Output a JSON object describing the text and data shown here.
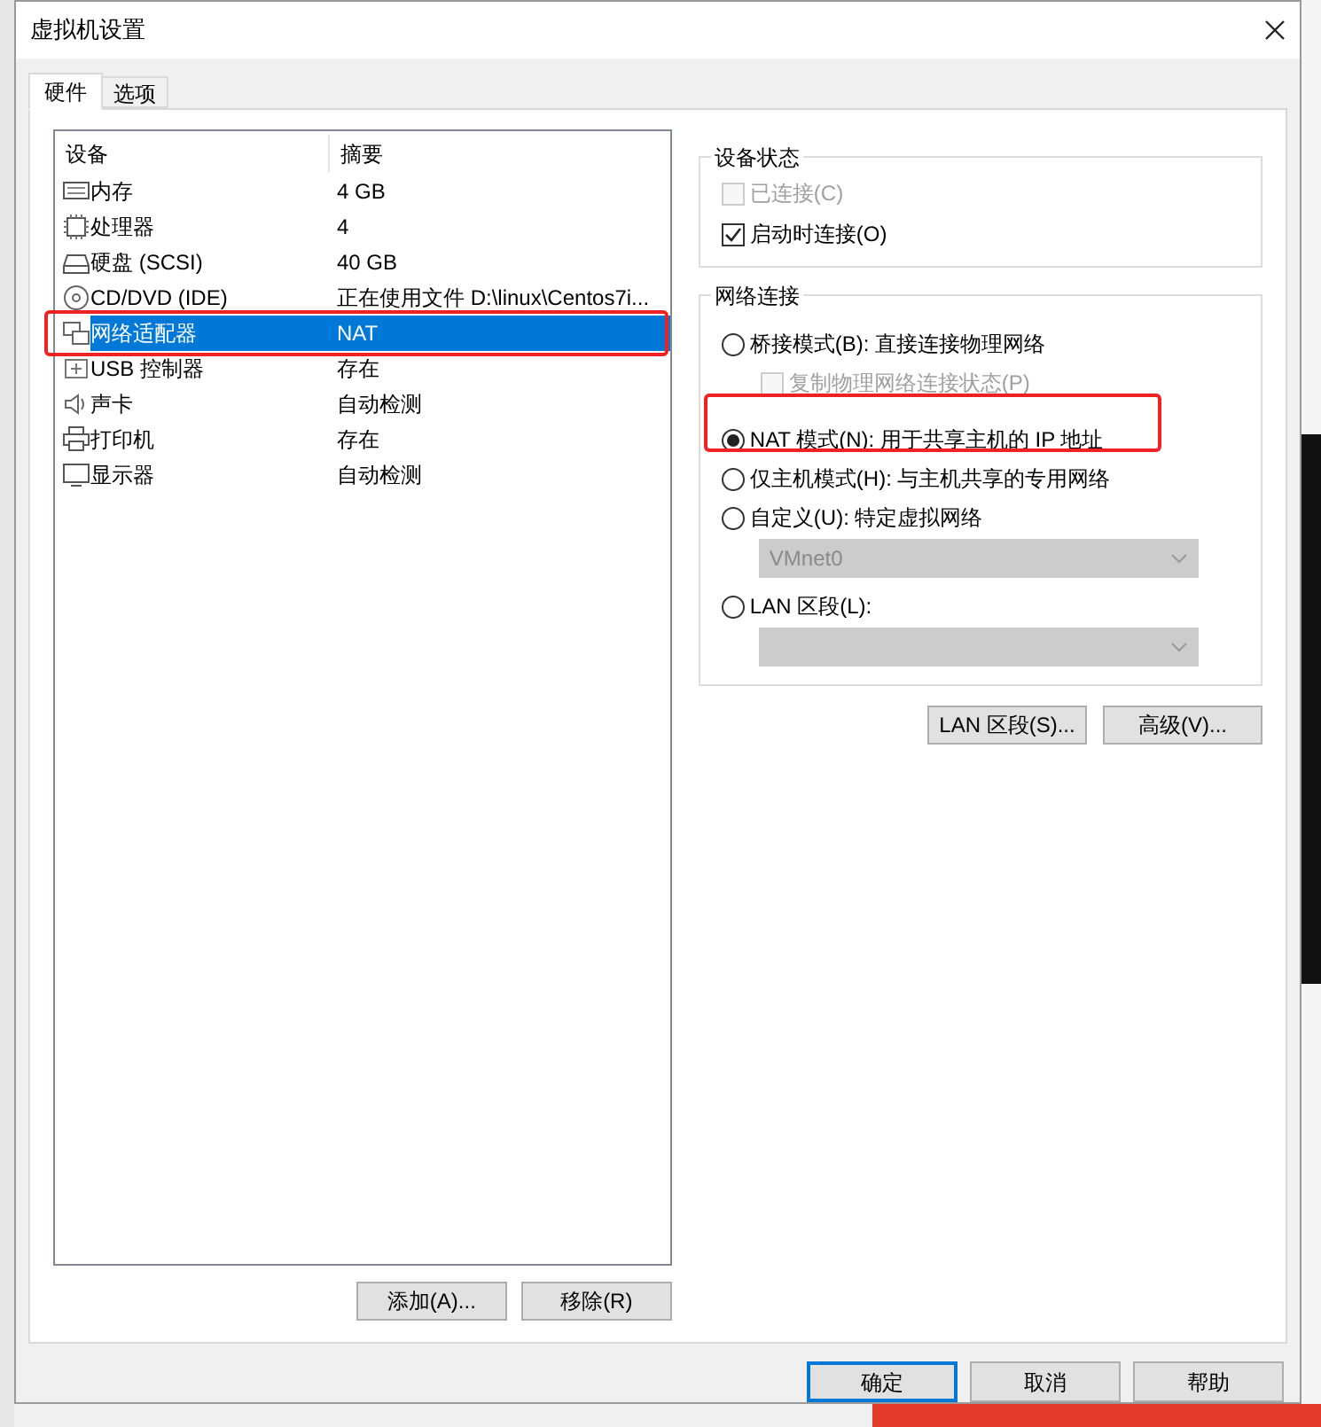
{
  "window": {
    "title": "虚拟机设置"
  },
  "tabs": [
    {
      "label": "硬件",
      "selected": true
    },
    {
      "label": "选项",
      "selected": false
    }
  ],
  "device_table": {
    "columns": [
      "设备",
      "摘要"
    ],
    "rows": [
      {
        "kind": "memory",
        "device": "内存",
        "summary": "4 GB",
        "selected": false
      },
      {
        "kind": "cpu",
        "device": "处理器",
        "summary": "4",
        "selected": false
      },
      {
        "kind": "disk",
        "device": "硬盘 (SCSI)",
        "summary": "40 GB",
        "selected": false
      },
      {
        "kind": "cd",
        "device": "CD/DVD (IDE)",
        "summary": "正在使用文件 D:\\linux\\Centos7i...",
        "selected": false
      },
      {
        "kind": "network",
        "device": "网络适配器",
        "summary": "NAT",
        "selected": true
      },
      {
        "kind": "usb",
        "device": "USB 控制器",
        "summary": "存在",
        "selected": false
      },
      {
        "kind": "sound",
        "device": "声卡",
        "summary": "自动检测",
        "selected": false
      },
      {
        "kind": "printer",
        "device": "打印机",
        "summary": "存在",
        "selected": false
      },
      {
        "kind": "display",
        "device": "显示器",
        "summary": "自动检测",
        "selected": false
      }
    ]
  },
  "list_buttons": [
    "添加(A)...",
    "移除(R)"
  ],
  "device_status": {
    "title": "设备状态",
    "options": [
      {
        "label": "已连接(C)",
        "checked": false,
        "disabled": true
      },
      {
        "label": "启动时连接(O)",
        "checked": true,
        "disabled": false
      }
    ]
  },
  "network_connection": {
    "title": "网络连接",
    "items": [
      {
        "kind": "radio",
        "label": "桥接模式(B): 直接连接物理网络",
        "selected": false,
        "disabled": false
      },
      {
        "kind": "checkbox",
        "label": "复制物理网络连接状态(P)",
        "checked": false,
        "disabled": true
      },
      {
        "kind": "radio",
        "label": "NAT 模式(N): 用于共享主机的 IP 地址",
        "selected": true,
        "disabled": false
      },
      {
        "kind": "radio",
        "label": "仅主机模式(H): 与主机共享的专用网络",
        "selected": false,
        "disabled": false
      },
      {
        "kind": "radio",
        "label": "自定义(U): 特定虚拟网络",
        "selected": false,
        "disabled": false
      },
      {
        "kind": "select",
        "value": "VMnet0",
        "disabled": true
      },
      {
        "kind": "radio",
        "label": "LAN 区段(L):",
        "selected": false,
        "disabled": false
      },
      {
        "kind": "select",
        "disabled": true
      }
    ]
  },
  "panel_buttons": [
    "LAN 区段(S)...",
    "高级(V)..."
  ],
  "dialog_buttons": [
    {
      "label": "确定",
      "focused": true
    },
    {
      "label": "取消",
      "focused": false
    },
    {
      "label": "帮助",
      "focused": false
    }
  ]
}
